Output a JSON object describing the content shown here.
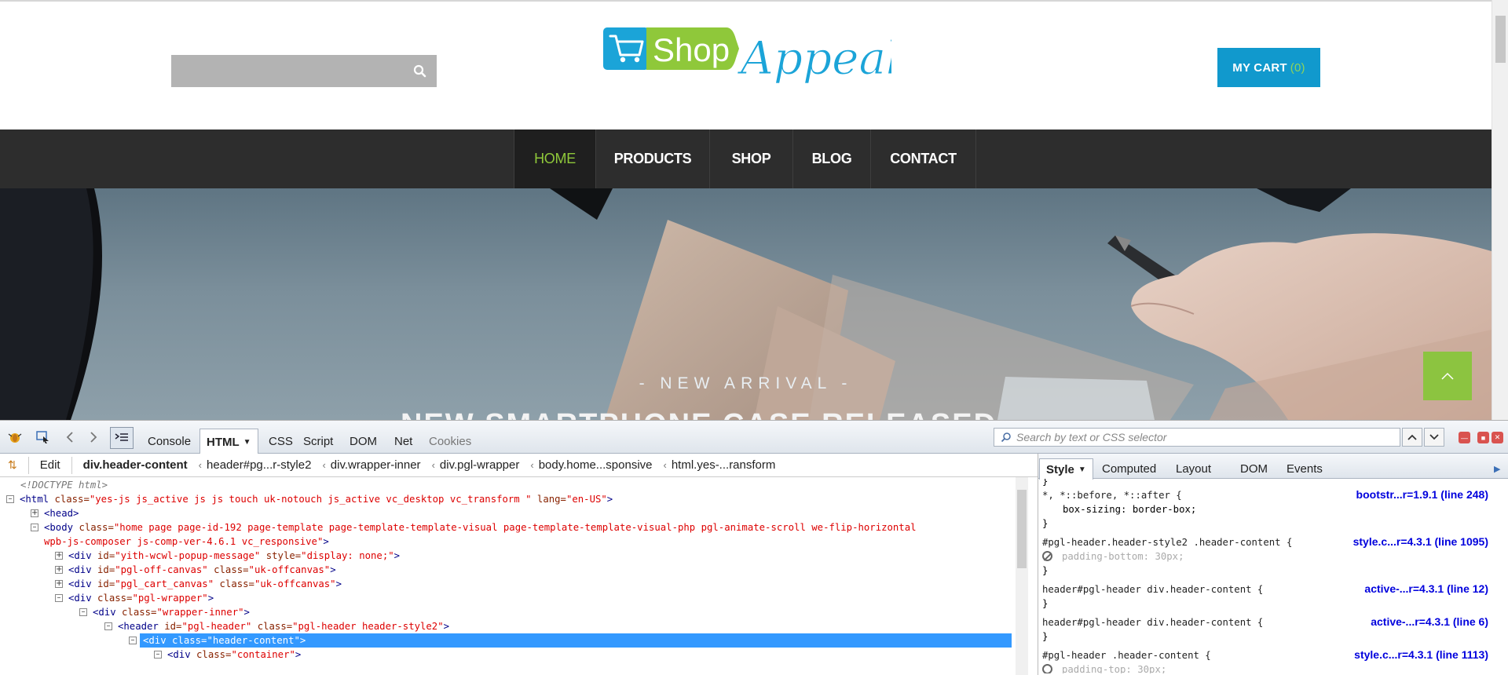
{
  "site": {
    "search_icon": "search-icon",
    "logo": {
      "left_text": "Shop",
      "right_text": "Appeal",
      "colors": {
        "green": "#8fc83a",
        "blue": "#1ba4d8"
      }
    },
    "cart": {
      "label": "MY CART",
      "count": "(0)"
    },
    "nav": [
      "HOME",
      "PRODUCTS",
      "SHOP",
      "BLOG",
      "CONTACT"
    ],
    "nav_active": "HOME",
    "hero": {
      "subtitle": "- NEW ARRIVAL -",
      "title_partial": "NEW SMARTPHONE CASE RELEASED"
    },
    "accent_color": "#1199cd",
    "nav_active_color": "#8fc83a"
  },
  "firebug": {
    "tabs": [
      "Console",
      "HTML",
      "CSS",
      "Script",
      "DOM",
      "Net",
      "Cookies"
    ],
    "active_tab": "HTML",
    "search_placeholder": "Search by text or CSS selector",
    "edit_label": "Edit",
    "breadcrumbs": [
      "div.header-content",
      "header#pg...r-style2",
      "div.wrapper-inner",
      "div.pgl-wrapper",
      "body.home...sponsive",
      "html.yes-...ransform"
    ],
    "tree": {
      "doctype": "<!DOCTYPE html>",
      "html_open": "<html",
      "html_class_attr": "class=",
      "html_class_val": "\"yes-js js_active js js touch uk-notouch js_active vc_desktop vc_transform \"",
      "html_lang_attr": "lang=",
      "html_lang_val": "\"en-US\"",
      "head": "<head>",
      "body_open": "<body",
      "body_class_attr": "class=",
      "body_class_val1": "\"home page page-id-192 page-template page-template-template-visual page-template-template-visual-php pgl-animate-scroll we-flip-horizontal",
      "body_class_val2": "wpb-js-composer js-comp-ver-4.6.1 vc_responsive\"",
      "div1_id_val": "\"yith-wcwl-popup-message\"",
      "div1_style_val": "\"display: none;\"",
      "div2_id_val": "\"pgl-off-canvas\"",
      "div2_class_val": "\"uk-offcanvas\"",
      "div3_id_val": "\"pgl_cart_canvas\"",
      "div3_class_val": "\"uk-offcanvas\"",
      "div4_class_val": "\"pgl-wrapper\"",
      "div5_class_val": "\"wrapper-inner\"",
      "header_id_val": "\"pgl-header\"",
      "header_class_val": "\"pgl-header header-style2\"",
      "div6_class_val": "\"header-content\"",
      "div7_class_val": "\"container\""
    },
    "side_tabs": [
      "Style",
      "Computed",
      "Layout",
      "DOM",
      "Events"
    ],
    "active_side_tab": "Style",
    "rules": [
      {
        "selector": "*, *::before, *::after {",
        "prop": "box-sizing: border-box;",
        "source": "bootstr...r=1.9.1 (line 248)"
      },
      {
        "selector": "#pgl-header.header-style2 .header-content {",
        "prop": "padding-bottom: 30px;",
        "source": "style.c...r=4.3.1 (line 1095)"
      },
      {
        "selector": "header#pgl-header div.header-content {",
        "source": "active-...r=4.3.1 (line 12)"
      },
      {
        "selector": "header#pgl-header div.header-content {",
        "source": "active-...r=4.3.1 (line 6)"
      },
      {
        "selector": "#pgl-header .header-content {",
        "prop": "padding-top: 30px;",
        "source": "style.c...r=4.3.1 (line 1113)"
      }
    ]
  }
}
